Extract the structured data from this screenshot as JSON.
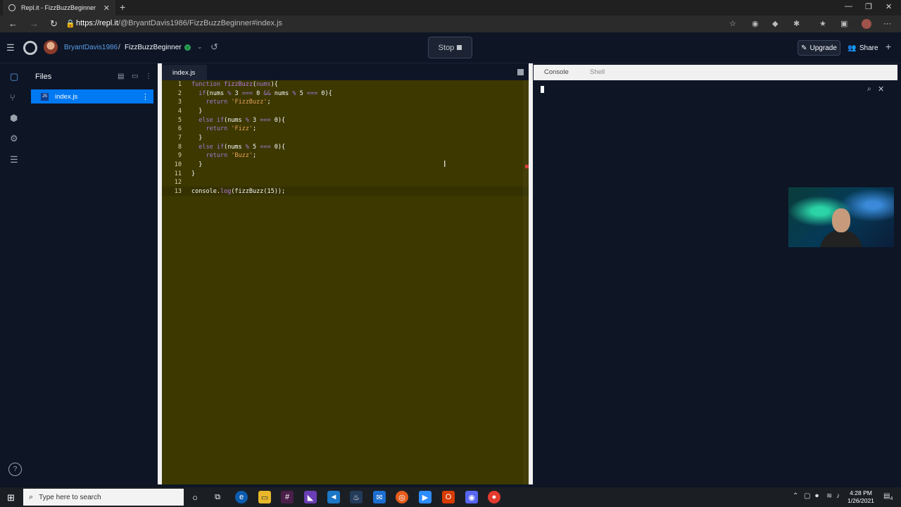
{
  "browser": {
    "tab_title": "Repl.it - FizzBuzzBeginner",
    "tab_close": "✕",
    "new_tab": "+",
    "window_controls": {
      "minimize": "—",
      "restore": "❐",
      "close": "✕"
    },
    "url_host": "https://repl.it",
    "url_path": "/@BryantDavis1986/FizzBuzzBeginner#index.js"
  },
  "header": {
    "user": "BryantDavis1986",
    "separator": "/",
    "repl_name": "FizzBuzzBeginner",
    "stop_label": "Stop",
    "upgrade_label": "Upgrade",
    "share_label": "Share"
  },
  "files_panel": {
    "title": "Files",
    "file_name": "index.js",
    "file_icon_text": "JS"
  },
  "editor": {
    "tab_label": "index.js",
    "lines": [
      "1",
      "2",
      "3",
      "4",
      "5",
      "6",
      "7",
      "8",
      "9",
      "10",
      "11",
      "12",
      "13"
    ]
  },
  "console": {
    "tab_console": "Console",
    "tab_shell": "Shell"
  },
  "taskbar": {
    "search_placeholder": "Type here to search",
    "time": "4:28 PM",
    "date": "1/26/2021",
    "notification_count": "4"
  },
  "colors": {
    "accent": "#0079f2",
    "editor_bg": "#3d3800",
    "console_bg": "#0e1525"
  },
  "icons": [
    "files-icon",
    "version-control-icon",
    "packages-icon",
    "settings-icon",
    "database-icon",
    "help-icon"
  ]
}
